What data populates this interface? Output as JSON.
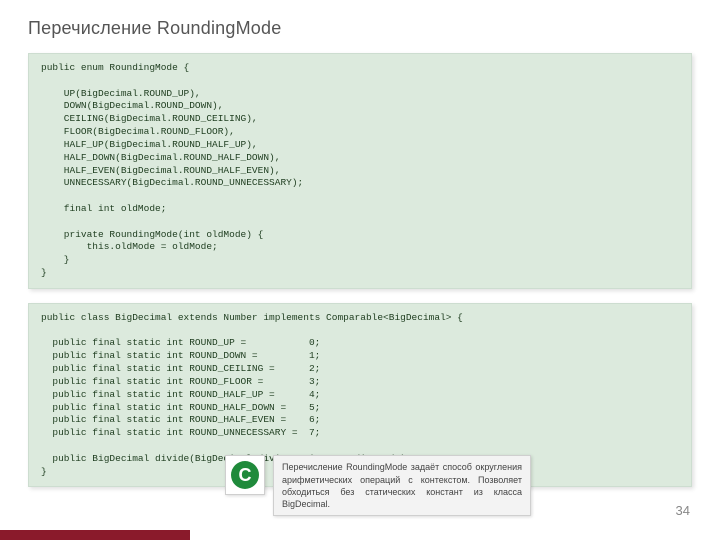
{
  "title": "Перечисление RoundingMode",
  "code_block_1": "public enum RoundingMode {\n\n    UP(BigDecimal.ROUND_UP),\n    DOWN(BigDecimal.ROUND_DOWN),\n    CEILING(BigDecimal.ROUND_CEILING),\n    FLOOR(BigDecimal.ROUND_FLOOR),\n    HALF_UP(BigDecimal.ROUND_HALF_UP),\n    HALF_DOWN(BigDecimal.ROUND_HALF_DOWN),\n    HALF_EVEN(BigDecimal.ROUND_HALF_EVEN),\n    UNNECESSARY(BigDecimal.ROUND_UNNECESSARY);\n\n    final int oldMode;\n\n    private RoundingMode(int oldMode) {\n        this.oldMode = oldMode;\n    }\n}",
  "code_block_2": "public class BigDecimal extends Number implements Comparable<BigDecimal> {\n\n  public final static int ROUND_UP =           0;\n  public final static int ROUND_DOWN =         1;\n  public final static int ROUND_CEILING =      2;\n  public final static int ROUND_FLOOR =        3;\n  public final static int ROUND_HALF_UP =      4;\n  public final static int ROUND_HALF_DOWN =    5;\n  public final static int ROUND_HALF_EVEN =    6;\n  public final static int ROUND_UNNECESSARY =  7;\n\n  public BigDecimal divide(BigDecimal divisor, int roundingMode)\n}",
  "note_icon_letter": "С",
  "note_text": "Перечисление RoundingMode задаёт способ округления арифметических операций с контекстом. Позволяет обходиться без статических констант из класса BigDecimal.",
  "page_number": "34"
}
